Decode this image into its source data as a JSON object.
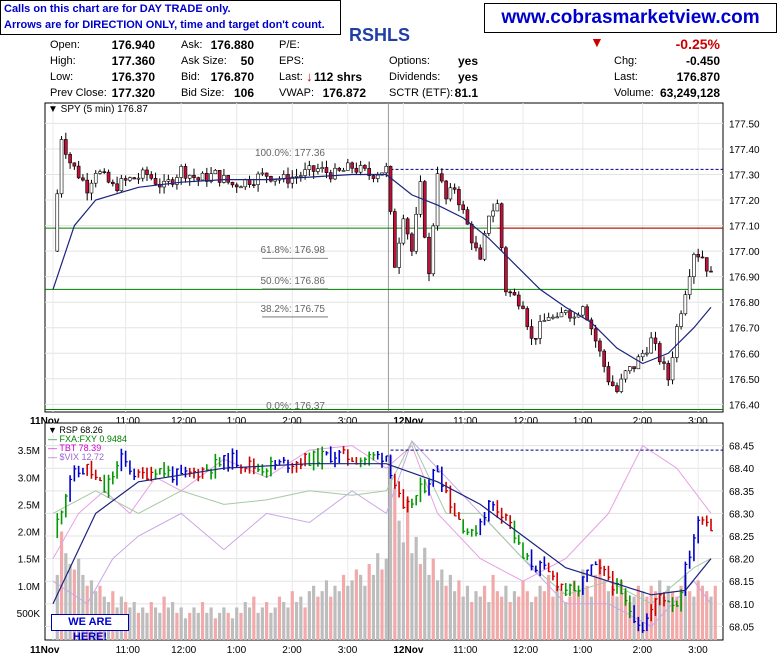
{
  "header": {
    "disclaimer_line1": "Calls on this chart are for DAY TRADE only.",
    "disclaimer_line2": "Arrows are for DIRECTION ONLY, time and target don't count.",
    "website": "www.cobrasmarketview.com",
    "symbol": "RSHLS",
    "change_pct": "-0.25%"
  },
  "quote": {
    "open_label": "Open:",
    "open": "176.940",
    "high_label": "High:",
    "high": "177.360",
    "low_label": "Low:",
    "low": "176.370",
    "prev_close_label": "Prev Close:",
    "prev_close": "177.320",
    "ask_label": "Ask:",
    "ask": "176.880",
    "ask_size_label": "Ask Size:",
    "ask_size": "50",
    "bid_label": "Bid:",
    "bid": "176.870",
    "bid_size_label": "Bid Size:",
    "bid_size": "106",
    "pe_label": "P/E:",
    "eps_label": "EPS:",
    "last_label": "Last:",
    "last_shrs": "112 shrs",
    "vwap_label": "VWAP:",
    "vwap": "176.872",
    "options_label": "Options:",
    "options": "yes",
    "dividends_label": "Dividends:",
    "dividends": "yes",
    "sctr_label": "SCTR (ETF):",
    "sctr": "81.1",
    "chg_label": "Chg:",
    "chg": "-0.450",
    "last2_label": "Last:",
    "last2": "176.870",
    "volume_label": "Volume:",
    "volume": "63,249,128"
  },
  "chart_data": [
    {
      "type": "candlestick",
      "legend": "SPY (5 min) 176.87",
      "ylim": [
        176.37,
        177.58
      ],
      "y_ticks": [
        "177.50",
        "177.40",
        "177.30",
        "177.20",
        "177.10",
        "177.00",
        "176.90",
        "176.80",
        "176.70",
        "176.60",
        "176.50",
        "176.40"
      ],
      "x_ticks": [
        "11Nov",
        "11:00",
        "12:00",
        "1:00",
        "2:00",
        "3:00",
        "12Nov",
        "11:00",
        "12:00",
        "1:00",
        "2:00",
        "3:00"
      ],
      "fib_levels": [
        {
          "label": "100.0%: 177.36",
          "value": 177.36
        },
        {
          "label": "61.8%: 176.98",
          "value": 176.98
        },
        {
          "label": "50.0%: 176.86",
          "value": 176.86
        },
        {
          "label": "38.2%: 176.75",
          "value": 176.75
        },
        {
          "label": "0.0%: 176.37",
          "value": 176.37
        }
      ],
      "h_lines": [
        {
          "value": 177.32,
          "color": "#000080",
          "style": "dashed"
        },
        {
          "value": 177.09,
          "color": "#008000",
          "style": "solid"
        },
        {
          "value": 176.85,
          "color": "#008000",
          "style": "solid"
        },
        {
          "value": 176.38,
          "color": "#008000",
          "style": "solid"
        }
      ],
      "red_line": {
        "value": 177.09,
        "from_day": 2
      },
      "close_path": [
        [
          0,
          177.0
        ],
        [
          2,
          177.45
        ],
        [
          4,
          177.35
        ],
        [
          6,
          177.3
        ],
        [
          8,
          177.25
        ],
        [
          10,
          177.32
        ],
        [
          14,
          177.25
        ],
        [
          18,
          177.28
        ],
        [
          22,
          177.3
        ],
        [
          26,
          177.25
        ],
        [
          30,
          177.32
        ],
        [
          34,
          177.28
        ],
        [
          38,
          177.3
        ],
        [
          42,
          177.26
        ],
        [
          46,
          177.28
        ],
        [
          50,
          177.3
        ],
        [
          54,
          177.28
        ],
        [
          58,
          177.3
        ],
        [
          62,
          177.32
        ],
        [
          66,
          177.3
        ],
        [
          70,
          177.33
        ],
        [
          74,
          177.3
        ],
        [
          78,
          177.32
        ],
        [
          80,
          176.95
        ],
        [
          82,
          177.15
        ],
        [
          84,
          177.0
        ],
        [
          86,
          177.25
        ],
        [
          88,
          176.9
        ],
        [
          90,
          177.32
        ],
        [
          92,
          177.2
        ],
        [
          94,
          177.25
        ],
        [
          96,
          177.15
        ],
        [
          98,
          177.05
        ],
        [
          100,
          176.95
        ],
        [
          102,
          177.15
        ],
        [
          104,
          177.18
        ],
        [
          106,
          176.85
        ],
        [
          108,
          176.82
        ],
        [
          110,
          176.8
        ],
        [
          112,
          176.65
        ],
        [
          114,
          176.7
        ],
        [
          116,
          176.75
        ],
        [
          118,
          176.72
        ],
        [
          120,
          176.78
        ],
        [
          122,
          176.74
        ],
        [
          124,
          176.8
        ],
        [
          126,
          176.7
        ],
        [
          128,
          176.6
        ],
        [
          130,
          176.5
        ],
        [
          132,
          176.45
        ],
        [
          134,
          176.52
        ],
        [
          136,
          176.55
        ],
        [
          138,
          176.6
        ],
        [
          140,
          176.65
        ],
        [
          142,
          176.58
        ],
        [
          144,
          176.5
        ],
        [
          146,
          176.7
        ],
        [
          148,
          176.85
        ],
        [
          150,
          177.0
        ],
        [
          152,
          176.98
        ],
        [
          154,
          176.9
        ]
      ],
      "ma_path": [
        [
          0,
          176.85
        ],
        [
          5,
          177.1
        ],
        [
          10,
          177.2
        ],
        [
          20,
          177.25
        ],
        [
          30,
          177.27
        ],
        [
          40,
          177.28
        ],
        [
          50,
          177.28
        ],
        [
          60,
          177.29
        ],
        [
          70,
          177.3
        ],
        [
          78,
          177.3
        ],
        [
          84,
          177.22
        ],
        [
          90,
          177.18
        ],
        [
          96,
          177.13
        ],
        [
          102,
          177.05
        ],
        [
          108,
          176.95
        ],
        [
          114,
          176.85
        ],
        [
          120,
          176.78
        ],
        [
          126,
          176.72
        ],
        [
          132,
          176.62
        ],
        [
          138,
          176.56
        ],
        [
          144,
          176.6
        ],
        [
          150,
          176.7
        ],
        [
          154,
          176.78
        ]
      ]
    },
    {
      "type": "line",
      "legend": [
        "RSP 68.26",
        "FXA:FXY 0.9484",
        "TBT 78.39",
        "$VIX 12.72"
      ],
      "series_colors": [
        "#000000",
        "#008000",
        "#cc00cc",
        "#9966cc"
      ],
      "ylim": [
        68.02,
        68.5
      ],
      "y_ticks": [
        "68.45",
        "68.40",
        "68.35",
        "68.30",
        "68.25",
        "68.20",
        "68.15",
        "68.10",
        "68.05"
      ],
      "volume_ticks": [
        "3.5M",
        "3.0M",
        "2.5M",
        "2.0M",
        "1.5M",
        "1.0M",
        "500K"
      ],
      "x_ticks": [
        "11Nov",
        "11:00",
        "12:00",
        "1:00",
        "2:00",
        "3:00",
        "12Nov",
        "11:00",
        "12:00",
        "1:00",
        "2:00",
        "3:00"
      ],
      "dashed_level": 68.44,
      "annotation": "WE ARE HERE!",
      "rsp_path": [
        [
          0,
          68.25
        ],
        [
          4,
          68.38
        ],
        [
          8,
          68.4
        ],
        [
          12,
          68.35
        ],
        [
          16,
          68.42
        ],
        [
          20,
          68.38
        ],
        [
          24,
          68.4
        ],
        [
          30,
          68.38
        ],
        [
          36,
          68.4
        ],
        [
          42,
          68.42
        ],
        [
          48,
          68.4
        ],
        [
          54,
          68.41
        ],
        [
          60,
          68.42
        ],
        [
          66,
          68.43
        ],
        [
          72,
          68.42
        ],
        [
          78,
          68.43
        ],
        [
          82,
          68.3
        ],
        [
          86,
          68.35
        ],
        [
          90,
          68.4
        ],
        [
          94,
          68.3
        ],
        [
          98,
          68.25
        ],
        [
          102,
          68.32
        ],
        [
          106,
          68.3
        ],
        [
          110,
          68.2
        ],
        [
          114,
          68.18
        ],
        [
          118,
          68.15
        ],
        [
          122,
          68.12
        ],
        [
          126,
          68.18
        ],
        [
          130,
          68.16
        ],
        [
          134,
          68.1
        ],
        [
          138,
          68.05
        ],
        [
          142,
          68.12
        ],
        [
          146,
          68.1
        ],
        [
          150,
          68.25
        ],
        [
          152,
          68.3
        ],
        [
          154,
          68.27
        ]
      ],
      "ma_path": [
        [
          0,
          68.1
        ],
        [
          10,
          68.3
        ],
        [
          20,
          68.37
        ],
        [
          40,
          68.4
        ],
        [
          60,
          68.41
        ],
        [
          78,
          68.41
        ],
        [
          90,
          68.37
        ],
        [
          100,
          68.32
        ],
        [
          110,
          68.25
        ],
        [
          120,
          68.18
        ],
        [
          130,
          68.15
        ],
        [
          140,
          68.12
        ],
        [
          148,
          68.13
        ],
        [
          154,
          68.2
        ]
      ],
      "tbt_path": [
        [
          0,
          68.2
        ],
        [
          6,
          68.3
        ],
        [
          12,
          68.35
        ],
        [
          18,
          68.3
        ],
        [
          24,
          68.38
        ],
        [
          30,
          68.35
        ],
        [
          40,
          68.42
        ],
        [
          50,
          68.38
        ],
        [
          60,
          68.44
        ],
        [
          70,
          68.45
        ],
        [
          78,
          68.4
        ],
        [
          84,
          68.45
        ],
        [
          90,
          68.3
        ],
        [
          100,
          68.2
        ],
        [
          110,
          68.15
        ],
        [
          120,
          68.2
        ],
        [
          130,
          68.3
        ],
        [
          138,
          68.45
        ],
        [
          146,
          68.4
        ],
        [
          154,
          68.3
        ]
      ],
      "vix_path": [
        [
          0,
          68.15
        ],
        [
          8,
          68.1
        ],
        [
          14,
          68.2
        ],
        [
          20,
          68.25
        ],
        [
          30,
          68.3
        ],
        [
          40,
          68.22
        ],
        [
          50,
          68.3
        ],
        [
          60,
          68.28
        ],
        [
          70,
          68.35
        ],
        [
          78,
          68.3
        ],
        [
          84,
          68.46
        ],
        [
          92,
          68.38
        ],
        [
          100,
          68.3
        ],
        [
          110,
          68.2
        ],
        [
          120,
          68.1
        ],
        [
          130,
          68.1
        ],
        [
          140,
          68.05
        ],
        [
          150,
          68.15
        ],
        [
          154,
          68.1
        ]
      ],
      "fxa_path": [
        [
          0,
          68.3
        ],
        [
          10,
          68.35
        ],
        [
          20,
          68.3
        ],
        [
          30,
          68.35
        ],
        [
          40,
          68.32
        ],
        [
          50,
          68.33
        ],
        [
          60,
          68.35
        ],
        [
          70,
          68.34
        ],
        [
          78,
          68.35
        ],
        [
          84,
          68.46
        ],
        [
          92,
          68.3
        ],
        [
          100,
          68.3
        ],
        [
          110,
          68.2
        ],
        [
          120,
          68.12
        ],
        [
          130,
          68.15
        ],
        [
          140,
          68.1
        ],
        [
          150,
          68.18
        ],
        [
          154,
          68.2
        ]
      ],
      "volume": [
        1.2,
        2.0,
        1.6,
        1.4,
        1.3,
        1.5,
        1.2,
        1.0,
        1.1,
        0.9,
        1.0,
        0.8,
        0.7,
        0.9,
        0.6,
        0.8,
        0.7,
        0.6,
        0.7,
        0.5,
        0.6,
        0.5,
        0.7,
        0.6,
        0.5,
        0.8,
        0.6,
        0.7,
        0.5,
        0.6,
        0.4,
        0.5,
        0.6,
        0.5,
        0.7,
        0.5,
        0.6,
        0.4,
        0.5,
        0.6,
        0.5,
        0.4,
        0.6,
        0.5,
        0.7,
        0.6,
        0.8,
        0.5,
        0.6,
        0.7,
        0.5,
        0.6,
        0.8,
        0.7,
        0.6,
        0.9,
        0.7,
        0.8,
        0.6,
        0.9,
        1.0,
        0.8,
        0.9,
        1.1,
        0.8,
        1.0,
        0.9,
        1.2,
        1.0,
        1.1,
        1.3,
        1.2,
        1.0,
        1.4,
        1.2,
        1.6,
        1.3,
        1.5,
        3.4,
        2.8,
        2.2,
        1.8,
        2.6,
        1.6,
        1.9,
        1.4,
        1.7,
        1.2,
        1.5,
        1.1,
        1.3,
        1.0,
        1.2,
        0.9,
        1.1,
        0.8,
        1.0,
        0.7,
        0.9,
        0.8,
        1.0,
        0.7,
        1.2,
        0.9,
        0.8,
        1.0,
        0.7,
        0.9,
        0.8,
        1.1,
        0.9,
        0.7,
        0.8,
        1.0,
        0.9,
        1.2,
        0.8,
        1.0,
        0.9,
        0.7,
        0.8,
        1.1,
        0.9,
        1.3,
        1.0,
        0.8,
        1.2,
        1.5,
        1.1,
        0.9,
        1.0,
        0.8,
        1.1,
        0.9,
        0.7,
        0.8,
        1.0,
        0.9,
        0.8,
        1.0,
        0.9,
        1.1,
        0.8,
        1.0,
        0.9,
        0.8,
        1.0,
        1.2,
        0.9,
        0.8,
        1.1,
        1.0,
        0.9,
        0.8,
        1.0
      ]
    }
  ]
}
